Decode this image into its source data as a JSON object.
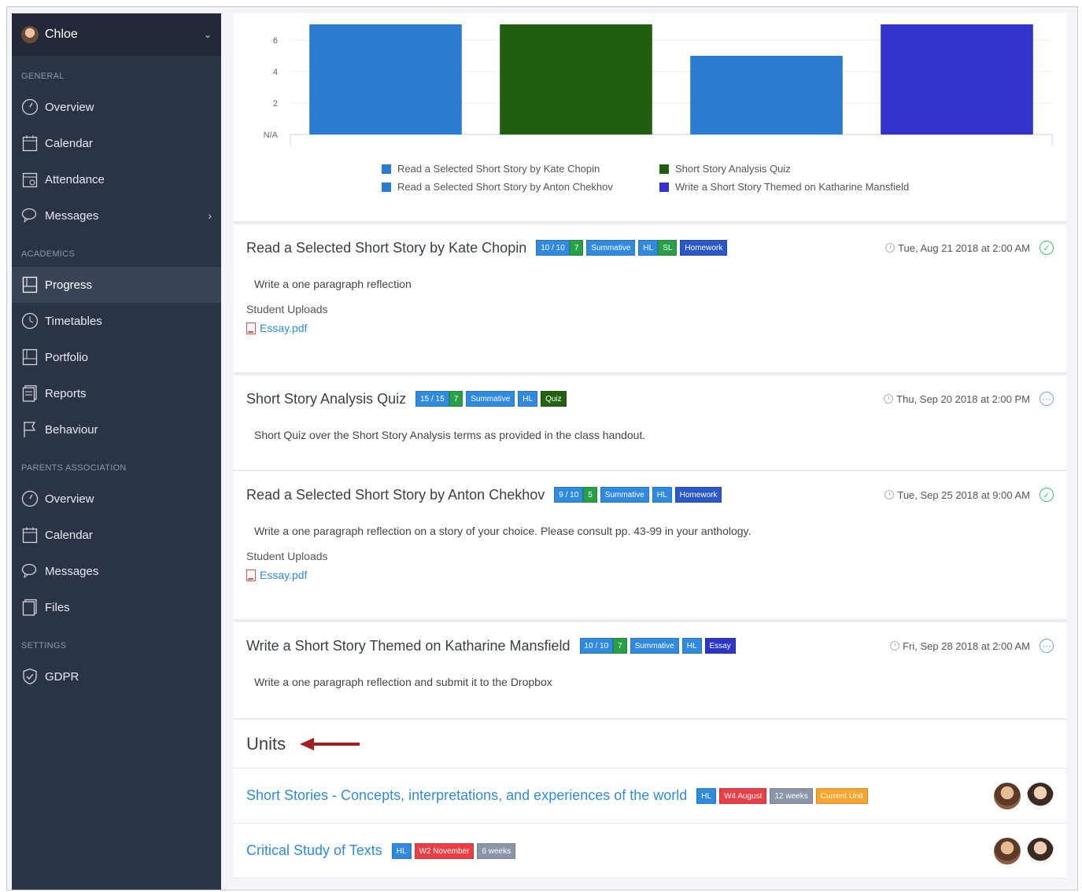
{
  "sidebar": {
    "user_name": "Chloe",
    "sections": [
      {
        "title": "GENERAL",
        "items": [
          {
            "label": "Overview",
            "icon": "gauge-icon"
          },
          {
            "label": "Calendar",
            "icon": "calendar-icon"
          },
          {
            "label": "Attendance",
            "icon": "attendance-icon"
          },
          {
            "label": "Messages",
            "icon": "chat-icon"
          }
        ]
      },
      {
        "title": "ACADEMICS",
        "items": [
          {
            "label": "Progress",
            "icon": "progress-icon"
          },
          {
            "label": "Timetables",
            "icon": "clock-icon"
          },
          {
            "label": "Portfolio",
            "icon": "portfolio-icon"
          },
          {
            "label": "Reports",
            "icon": "report-icon"
          },
          {
            "label": "Behaviour",
            "icon": "flag-icon"
          }
        ]
      },
      {
        "title": "PARENTS ASSOCIATION",
        "items": [
          {
            "label": "Overview",
            "icon": "gauge-icon"
          },
          {
            "label": "Calendar",
            "icon": "calendar-icon"
          },
          {
            "label": "Messages",
            "icon": "chat-icon"
          },
          {
            "label": "Files",
            "icon": "files-icon"
          }
        ]
      },
      {
        "title": "SETTINGS",
        "items": [
          {
            "label": "GDPR",
            "icon": "shield-icon"
          }
        ]
      }
    ],
    "active_item": "Progress"
  },
  "chart_data": {
    "type": "bar",
    "categories": [
      "Read a Selected Short Story by Kate Chopin",
      "Short Story Analysis Quiz",
      "Read a Selected Short Story by Anton Chekhov",
      "Write a Short Story Themed on Katharine Mansfield"
    ],
    "values": [
      7,
      7,
      5,
      7
    ],
    "colors": [
      "#2a7bd2",
      "#215e10",
      "#2a7bd2",
      "#3232cc"
    ],
    "ytick_labels": [
      "N/A",
      "2",
      "4",
      "6"
    ],
    "ylim": [
      0,
      7
    ],
    "grid": true,
    "legend": [
      "Read a Selected Short Story by Kate Chopin",
      "Short Story Analysis Quiz",
      "Read a Selected Short Story by Anton Chekhov",
      "Write a Short Story Themed on Katharine Mansfield"
    ]
  },
  "assignments": [
    {
      "title": "Read a Selected Short Story by Kate Chopin",
      "score": "10 / 10",
      "grade": "7",
      "tags": [
        "Summative",
        "HL",
        "SL",
        "Homework"
      ],
      "date": "Tue, Aug 21 2018 at 2:00 AM",
      "status": "complete",
      "description": "Write a one paragraph reflection",
      "uploads_label": "Student Uploads",
      "file": "Essay.pdf"
    },
    {
      "title": "Short Story Analysis Quiz",
      "score": "15 / 15",
      "grade": "7",
      "tags": [
        "Summative",
        "HL",
        "Quiz"
      ],
      "date": "Thu, Sep 20 2018 at 2:00 PM",
      "status": "pending",
      "description": "Short Quiz over the Short Story Analysis terms as provided in the class handout."
    },
    {
      "title": "Read a Selected Short Story by Anton Chekhov",
      "score": "9 / 10",
      "grade": "5",
      "tags": [
        "Summative",
        "HL",
        "Homework"
      ],
      "date": "Tue, Sep 25 2018 at 9:00 AM",
      "status": "complete",
      "description": "Write a one paragraph reflection on a story of your choice. Please consult pp. 43-99 in your anthology.",
      "uploads_label": "Student Uploads",
      "file": "Essay.pdf"
    },
    {
      "title": "Write a Short Story Themed on Katharine Mansfield",
      "score": "10 / 10",
      "grade": "7",
      "tags": [
        "Summative",
        "HL",
        "Essay"
      ],
      "date": "Fri, Sep 28 2018 at 2:00 AM",
      "status": "pending",
      "description": "Write a one paragraph reflection and submit it to the Dropbox"
    }
  ],
  "units": {
    "heading": "Units",
    "items": [
      {
        "title": "Short Stories - Concepts, interpretations, and experiences of the world",
        "tags": [
          "HL",
          "W4 August",
          "12 weeks",
          "Current Unit"
        ]
      },
      {
        "title": "Critical Study of Texts",
        "tags": [
          "HL",
          "W2 November",
          "6 weeks"
        ]
      }
    ]
  }
}
